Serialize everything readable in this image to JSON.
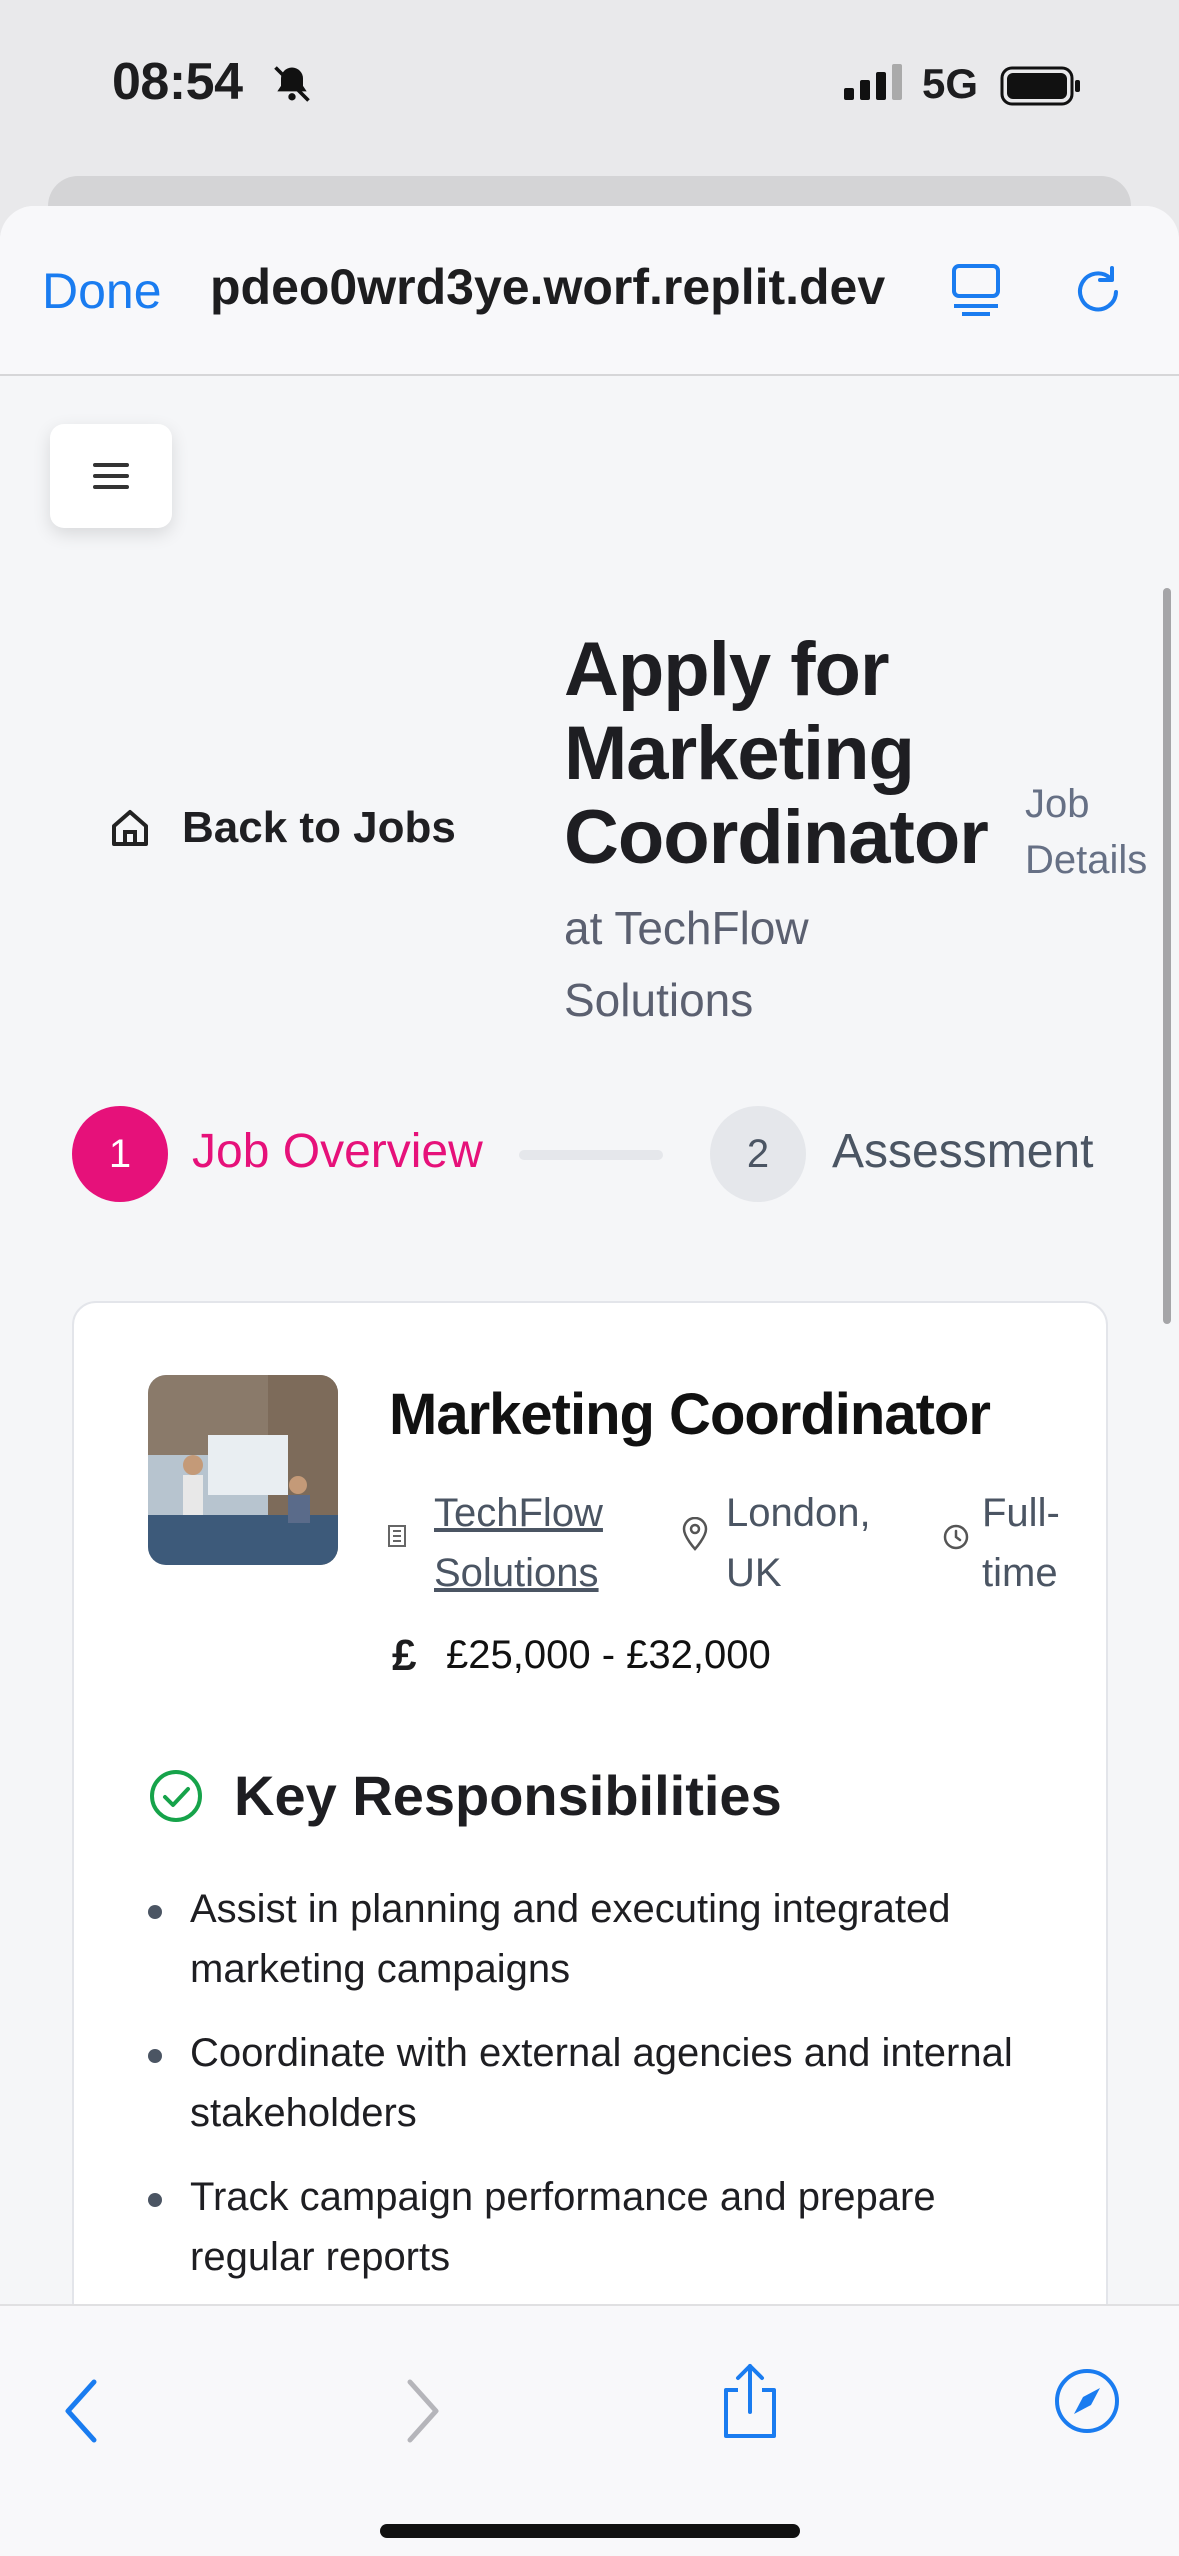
{
  "status_bar": {
    "time": "08:54",
    "network": "5G"
  },
  "browser": {
    "done_label": "Done",
    "url": "pdeo0wrd3ye.worf.replit.dev",
    "icons": [
      "reader-mode-icon",
      "reload-icon"
    ]
  },
  "header": {
    "back_label": "Back to Jobs",
    "title": "Apply for Marketing Coordinator",
    "subtitle": "at TechFlow Solutions",
    "job_details_label": "Job Details"
  },
  "steps": [
    {
      "number": "1",
      "label": "Job Overview",
      "active": true
    },
    {
      "number": "2",
      "label": "Assessment",
      "active": false
    }
  ],
  "job": {
    "title": "Marketing Coordinator",
    "company": "TechFlow Solutions",
    "location": "London, UK",
    "type": "Full-time",
    "salary_icon": "£",
    "salary": "£25,000 - £32,000"
  },
  "responsibilities": {
    "heading": "Key Responsibilities",
    "items": [
      "Assist in planning and executing integrated marketing campaigns",
      "Coordinate with external agencies and internal stakeholders",
      "Track campaign performance and prepare regular reports"
    ]
  },
  "colors": {
    "accent": "#e6117a",
    "link": "#1a7cf0",
    "success": "#16a34a"
  }
}
